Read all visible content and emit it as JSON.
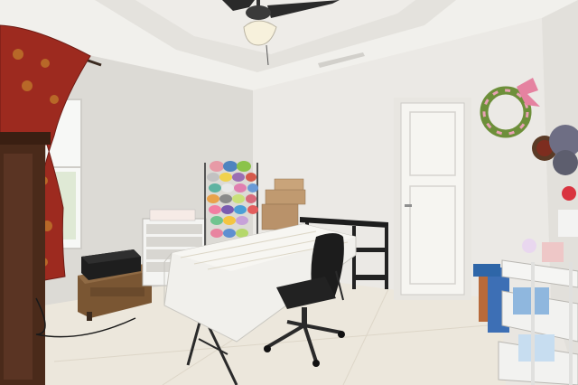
{
  "scene": {
    "alt": "Craft room",
    "colors": {
      "wall": "#e6e4df",
      "ceiling": "#f0efeb",
      "floor": "#ece7dd",
      "curtain": "#a0281e",
      "curtain_pattern": "#c9932f",
      "door": "#f4f3ef",
      "table_cloth": "#f3f2ee",
      "wood": "#4a2a1a",
      "chair": "#1b1b1b"
    },
    "objects": [
      "ceiling-fan",
      "curtain",
      "window",
      "armoire",
      "printer",
      "drawer-unit",
      "ribbon-rack",
      "cardboard-boxes",
      "desk",
      "sewing-table",
      "office-chair",
      "door",
      "wreaths",
      "rolling-cart",
      "wall-vent"
    ]
  }
}
